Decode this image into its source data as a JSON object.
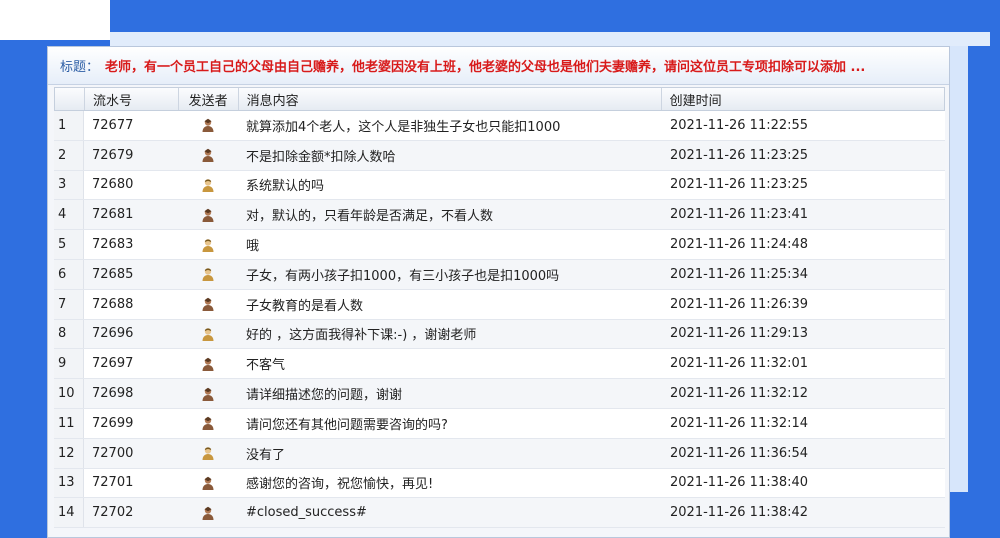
{
  "title": {
    "label": "标题：",
    "text": "老师，有一个员工自己的父母由自己赡养，他老婆因没有上班，他老婆的父母也是他们夫妻赡养，请问这位员工专项扣除可以添加 ..."
  },
  "columns": {
    "serial": "流水号",
    "sender": "发送者",
    "message": "消息内容",
    "created": "创建时间"
  },
  "rows": [
    {
      "idx": "1",
      "serial": "72677",
      "sender_icon": "teacher-avatar-icon",
      "message": "就算添加4个老人，这个人是非独生子女也只能扣1000",
      "created": "2021-11-26 11:22:55"
    },
    {
      "idx": "2",
      "serial": "72679",
      "sender_icon": "teacher-avatar-icon",
      "message": "不是扣除金额*扣除人数哈",
      "created": "2021-11-26 11:23:25"
    },
    {
      "idx": "3",
      "serial": "72680",
      "sender_icon": "user-avatar-icon",
      "message": "系统默认的吗",
      "created": "2021-11-26 11:23:25"
    },
    {
      "idx": "4",
      "serial": "72681",
      "sender_icon": "teacher-avatar-icon",
      "message": "对，默认的，只看年龄是否满足，不看人数",
      "created": "2021-11-26 11:23:41"
    },
    {
      "idx": "5",
      "serial": "72683",
      "sender_icon": "user-avatar-icon",
      "message": "哦",
      "created": "2021-11-26 11:24:48"
    },
    {
      "idx": "6",
      "serial": "72685",
      "sender_icon": "user-avatar-icon",
      "message": "子女，有两小孩子扣1000，有三小孩子也是扣1000吗",
      "created": "2021-11-26 11:25:34"
    },
    {
      "idx": "7",
      "serial": "72688",
      "sender_icon": "teacher-avatar-icon",
      "message": "子女教育的是看人数",
      "created": "2021-11-26 11:26:39"
    },
    {
      "idx": "8",
      "serial": "72696",
      "sender_icon": "user-avatar-icon",
      "message": "好的 ，这方面我得补下课:-) ，谢谢老师",
      "created": "2021-11-26 11:29:13"
    },
    {
      "idx": "9",
      "serial": "72697",
      "sender_icon": "teacher-avatar-icon",
      "message": "不客气",
      "created": "2021-11-26 11:32:01"
    },
    {
      "idx": "10",
      "serial": "72698",
      "sender_icon": "teacher-avatar-icon",
      "message": "请详细描述您的问题，谢谢",
      "created": "2021-11-26 11:32:12"
    },
    {
      "idx": "11",
      "serial": "72699",
      "sender_icon": "teacher-avatar-icon",
      "message": "请问您还有其他问题需要咨询的吗?",
      "created": "2021-11-26 11:32:14"
    },
    {
      "idx": "12",
      "serial": "72700",
      "sender_icon": "user-avatar-icon",
      "message": "没有了",
      "created": "2021-11-26 11:36:54"
    },
    {
      "idx": "13",
      "serial": "72701",
      "sender_icon": "teacher-avatar-icon",
      "message": "感谢您的咨询，祝您愉快，再见!",
      "created": "2021-11-26 11:38:40"
    },
    {
      "idx": "14",
      "serial": "72702",
      "sender_icon": "teacher-avatar-icon",
      "message": "#closed_success#",
      "created": "2021-11-26 11:38:42"
    }
  ],
  "colors": {
    "title_text": "#d81a1a",
    "title_label": "#2e5fa6",
    "background_blue": "#2f6fe0"
  }
}
